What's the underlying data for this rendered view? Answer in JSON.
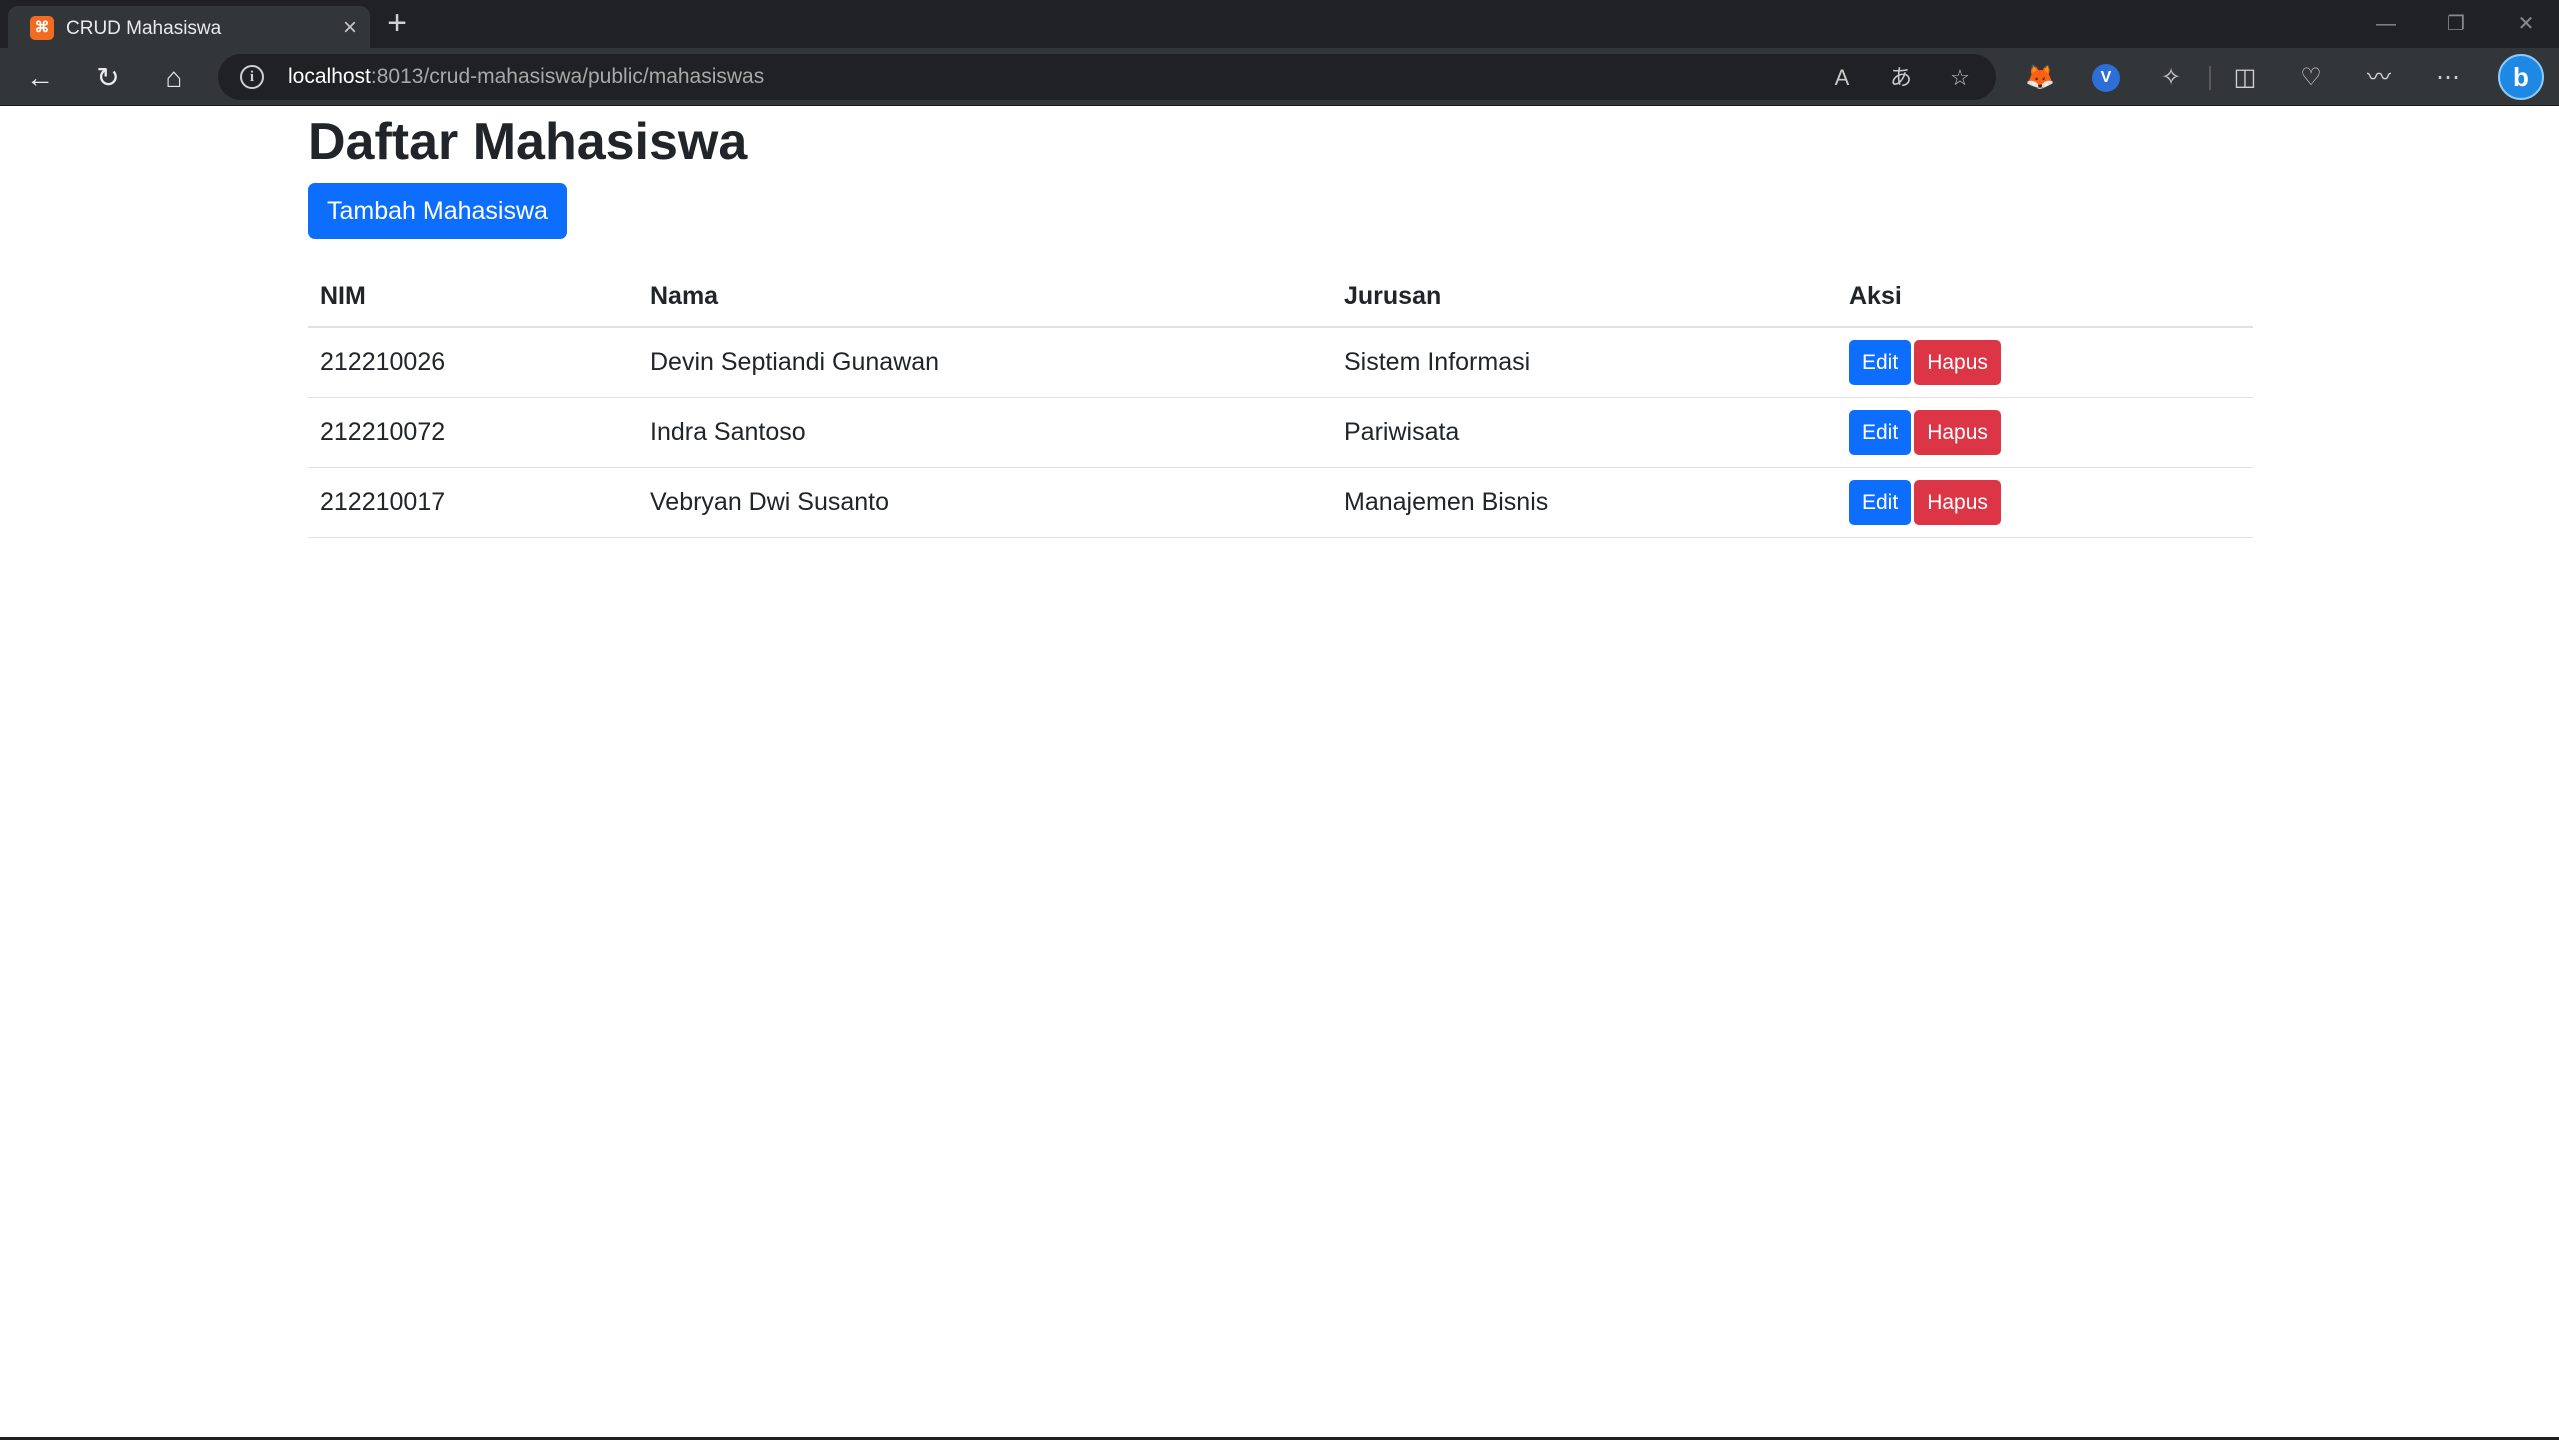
{
  "browser": {
    "tab_title": "CRUD Mahasiswa",
    "favicon_letter": "⌘",
    "url_host": "localhost",
    "url_rest": ":8013/crud-mahasiswa/public/mahasiswas",
    "tab_close": "×",
    "new_tab": "+",
    "icons": {
      "back": "←",
      "refresh": "↻",
      "home": "⌂",
      "info": "i",
      "read_aloud": "A",
      "translate": "あ",
      "favorite": "☆",
      "metamask": "🦊",
      "ext_v": "V",
      "extensions": "✧",
      "split": "◫",
      "health": "♡",
      "performance": "〰",
      "more": "⋯",
      "bing": "b",
      "minimize": "—",
      "restore": "❐",
      "close": "✕"
    }
  },
  "page": {
    "title": "Daftar Mahasiswa",
    "add_button": "Tambah Mahasiswa",
    "table": {
      "headers": [
        "NIM",
        "Nama",
        "Jurusan",
        "Aksi"
      ],
      "rows": [
        {
          "nim": "212210026",
          "nama": "Devin Septiandi Gunawan",
          "jurusan": "Sistem Informasi",
          "edit": "Edit",
          "hapus": "Hapus"
        },
        {
          "nim": "212210072",
          "nama": "Indra Santoso",
          "jurusan": "Pariwisata",
          "edit": "Edit",
          "hapus": "Hapus"
        },
        {
          "nim": "212210017",
          "nama": "Vebryan Dwi Susanto",
          "jurusan": "Manajemen Bisnis",
          "edit": "Edit",
          "hapus": "Hapus"
        }
      ]
    }
  },
  "colors": {
    "primary": "#0d6efd",
    "danger": "#dc3545",
    "chrome_dark": "#202124",
    "chrome_toolbar": "#323639"
  }
}
